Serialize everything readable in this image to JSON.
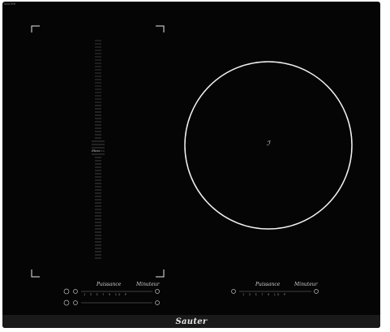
{
  "brand": "Sauter",
  "corner_logo": "SAUTER",
  "model_text": "",
  "series_text": "",
  "left_zone": {
    "label": "Flexi"
  },
  "right_zone": {
    "marker": "ℐ"
  },
  "controls_left": {
    "power_script": "Puissance",
    "minuteur_script": "Minuteur",
    "level_scale": "1 3 5 7 9 10 P"
  },
  "controls_right": {
    "power_script": "Puissance",
    "minuteur_script": "Minuteur",
    "level_scale": "1 3 5 7 9 10 P"
  },
  "colors": {
    "glass": "#050505",
    "lines": "#e6e6e6",
    "strip": "#1a1a1a"
  }
}
